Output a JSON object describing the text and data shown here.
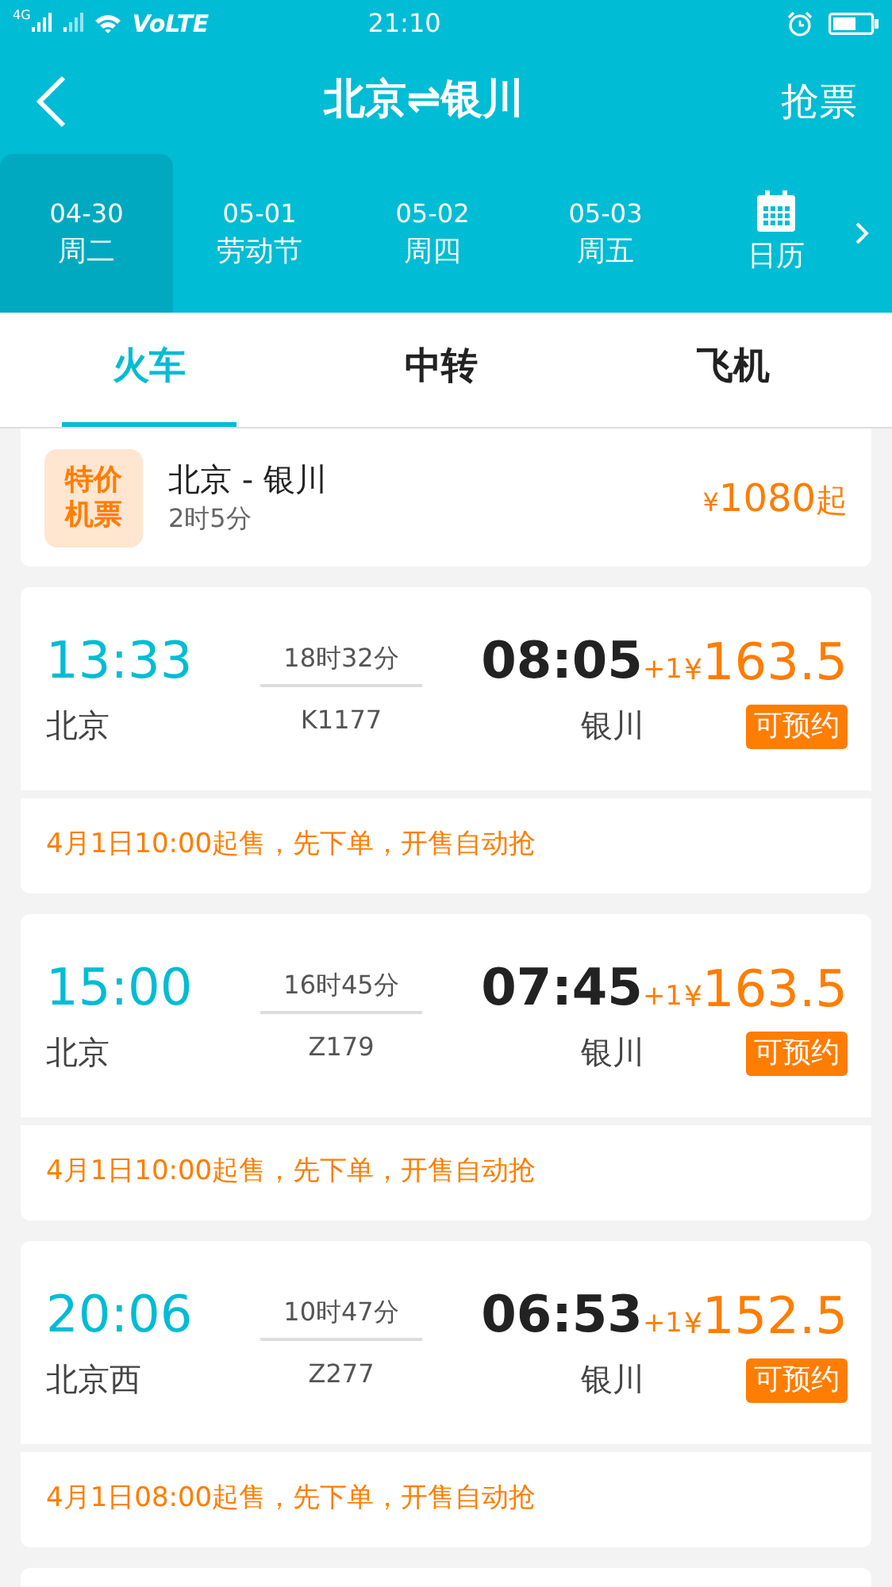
{
  "status_bar": {
    "network": "4G",
    "volte": "VoLTE",
    "time": "21:10"
  },
  "header": {
    "title": "北京⇌银川",
    "action": "抢票"
  },
  "dates": [
    {
      "date": "04-30",
      "label": "周二",
      "selected": true
    },
    {
      "date": "05-01",
      "label": "劳动节",
      "selected": false
    },
    {
      "date": "05-02",
      "label": "周四",
      "selected": false
    },
    {
      "date": "05-03",
      "label": "周五",
      "selected": false
    }
  ],
  "calendar": {
    "label": "日历"
  },
  "tabs": [
    {
      "label": "火车",
      "selected": true
    },
    {
      "label": "中转",
      "selected": false
    },
    {
      "label": "飞机",
      "selected": false
    }
  ],
  "flight_offer": {
    "badge": "特价机票",
    "route": "北京 - 银川",
    "duration": "2时5分",
    "currency": "¥",
    "price": "1080",
    "suffix": "起"
  },
  "trains": [
    {
      "depart": "13:33",
      "from": "北京",
      "duration": "18时32分",
      "number": "K1177",
      "arrive": "08:05",
      "day_offset": "+1",
      "to": "银川",
      "currency": "¥",
      "price": "163.5",
      "status": "可预约",
      "note": "4月1日10:00起售，先下单，开售自动抢"
    },
    {
      "depart": "15:00",
      "from": "北京",
      "duration": "16时45分",
      "number": "Z179",
      "arrive": "07:45",
      "day_offset": "+1",
      "to": "银川",
      "currency": "¥",
      "price": "163.5",
      "status": "可预约",
      "note": "4月1日10:00起售，先下单，开售自动抢"
    },
    {
      "depart": "20:06",
      "from": "北京西",
      "duration": "10时47分",
      "number": "Z277",
      "arrive": "06:53",
      "day_offset": "+1",
      "to": "银川",
      "currency": "¥",
      "price": "152.5",
      "status": "可预约",
      "note": "4月1日08:00起售，先下单，开售自动抢"
    }
  ]
}
